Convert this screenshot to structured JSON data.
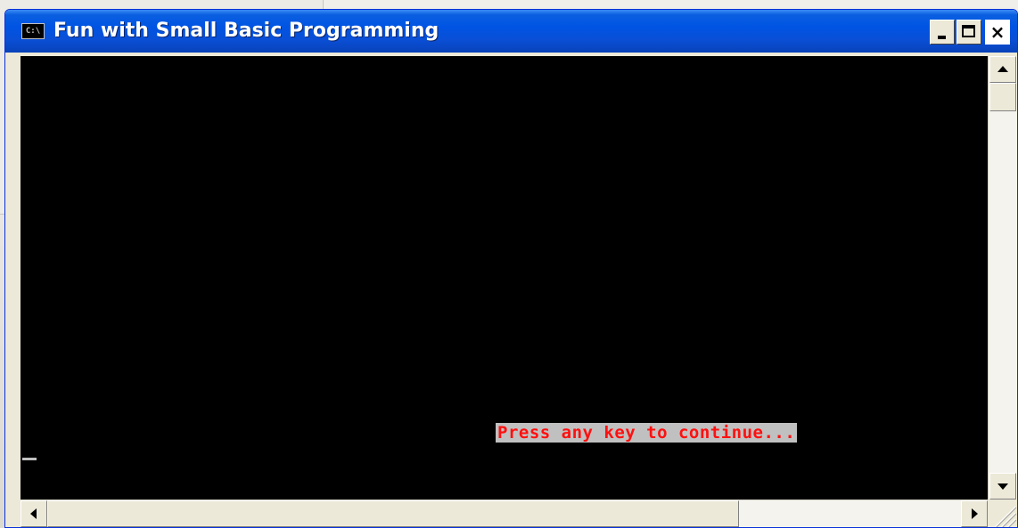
{
  "window": {
    "title": "Fun with Small Basic Programming",
    "icon": "console-window-icon",
    "icon_text": "C:\\"
  },
  "caption_buttons": {
    "minimize": "minimize-icon",
    "maximize": "maximize-icon",
    "close": "close-icon",
    "close_glyph": "×"
  },
  "console": {
    "prompt_text": "Press any key to continue...",
    "prompt_color": "#ff1010",
    "prompt_background": "#c0c0c0",
    "background": "#000000",
    "cursor_color": "#c0c0c0"
  },
  "colors": {
    "titlebar": "#0054e3",
    "title_text": "#ffffff",
    "window_frame": "#ece9d8"
  }
}
